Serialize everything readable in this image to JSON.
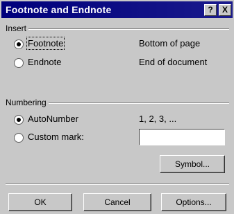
{
  "dialog": {
    "title": "Footnote and Endnote",
    "help_button": "?",
    "close_button": "X"
  },
  "insert": {
    "group_label": "Insert",
    "options": [
      {
        "label": "Footnote",
        "selected": true,
        "description": "Bottom of page"
      },
      {
        "label": "Endnote",
        "selected": false,
        "description": "End of document"
      }
    ]
  },
  "numbering": {
    "group_label": "Numbering",
    "options": [
      {
        "label": "AutoNumber",
        "selected": true,
        "description": "1, 2, 3, ..."
      },
      {
        "label": "Custom mark:",
        "selected": false
      }
    ],
    "custom_mark_value": "",
    "symbol_button": "Symbol..."
  },
  "buttons": {
    "ok": "OK",
    "cancel": "Cancel",
    "options": "Options..."
  }
}
